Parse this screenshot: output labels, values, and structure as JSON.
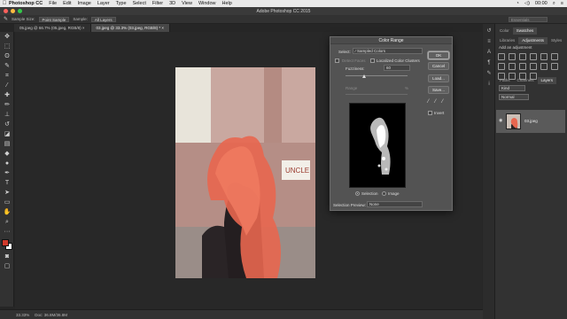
{
  "menubar": {
    "app": "Photoshop CC",
    "items": [
      "File",
      "Edit",
      "Image",
      "Layer",
      "Type",
      "Select",
      "Filter",
      "3D",
      "View",
      "Window",
      "Help"
    ],
    "time": "00:00"
  },
  "window_title": "Adobe Photoshop CC 2015",
  "options": {
    "sample_size_label": "Sample Size:",
    "sample_size_value": "Point Sample",
    "sample_label": "Sample:",
    "sample_value": "All Layers",
    "search_placeholder": "Essentials"
  },
  "doc_tabs": [
    {
      "label": "05.jpeg @ 66.7% (05.jpeg, RGB/8) ×",
      "active": false
    },
    {
      "label": "03.jpeg @ 33.3% (03.jpeg, RGB/8) * ×",
      "active": true
    }
  ],
  "status": {
    "zoom": "33.33%",
    "doc": "Doc: 36.8M/36.8M"
  },
  "dialog": {
    "title": "Color Range",
    "select_label": "Select:",
    "select_value": "Sampled Colors",
    "detect_faces": "Detect Faces",
    "localized": "Localized Color Clusters",
    "fuzziness_label": "Fuzziness:",
    "fuzziness_value": "60",
    "fuzziness_fraction": 0.3,
    "range_label": "Range",
    "range_value": "%",
    "selection_label": "Selection",
    "image_label": "Image",
    "preview_label": "Selection Preview:",
    "preview_value": "None",
    "buttons": {
      "ok": "OK",
      "cancel": "Cancel",
      "load": "Load...",
      "save": "Save..."
    },
    "invert": "Invert"
  },
  "panels": {
    "top_tabs": [
      "Color",
      "Swatches"
    ],
    "mid_tabs": [
      "Libraries",
      "Adjustments",
      "Styles"
    ],
    "add_adjustment": "Add an adjustment",
    "layer_tabs": [
      "Paths",
      "Channels",
      "Layers"
    ],
    "layer_kind": "Kind",
    "layer_normal": "Normal",
    "layer_name": "03.jpeg"
  }
}
